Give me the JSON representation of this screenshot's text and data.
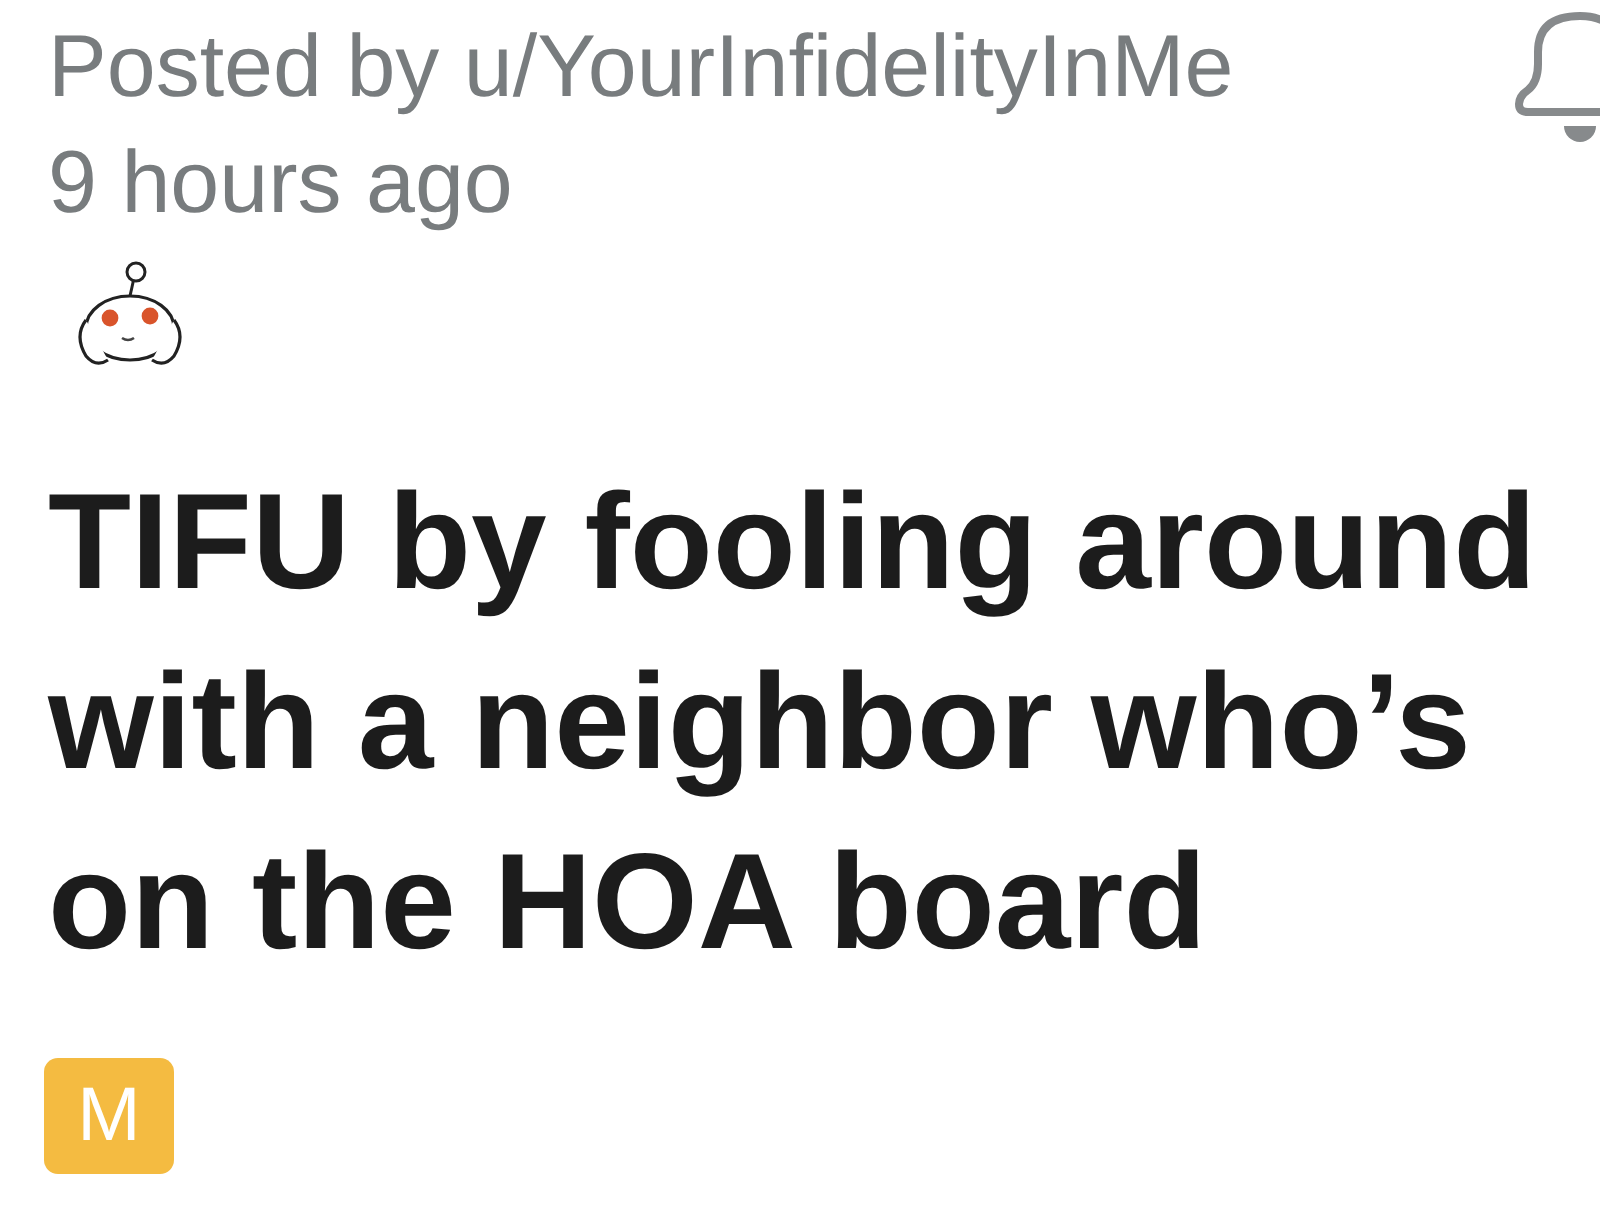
{
  "post": {
    "author_line": "Posted by u/YourInfidelityInMe",
    "time": "9 hours ago",
    "title": "TIFU by fooling around with a neighbor who’s on the HOA board",
    "flair": "M"
  }
}
